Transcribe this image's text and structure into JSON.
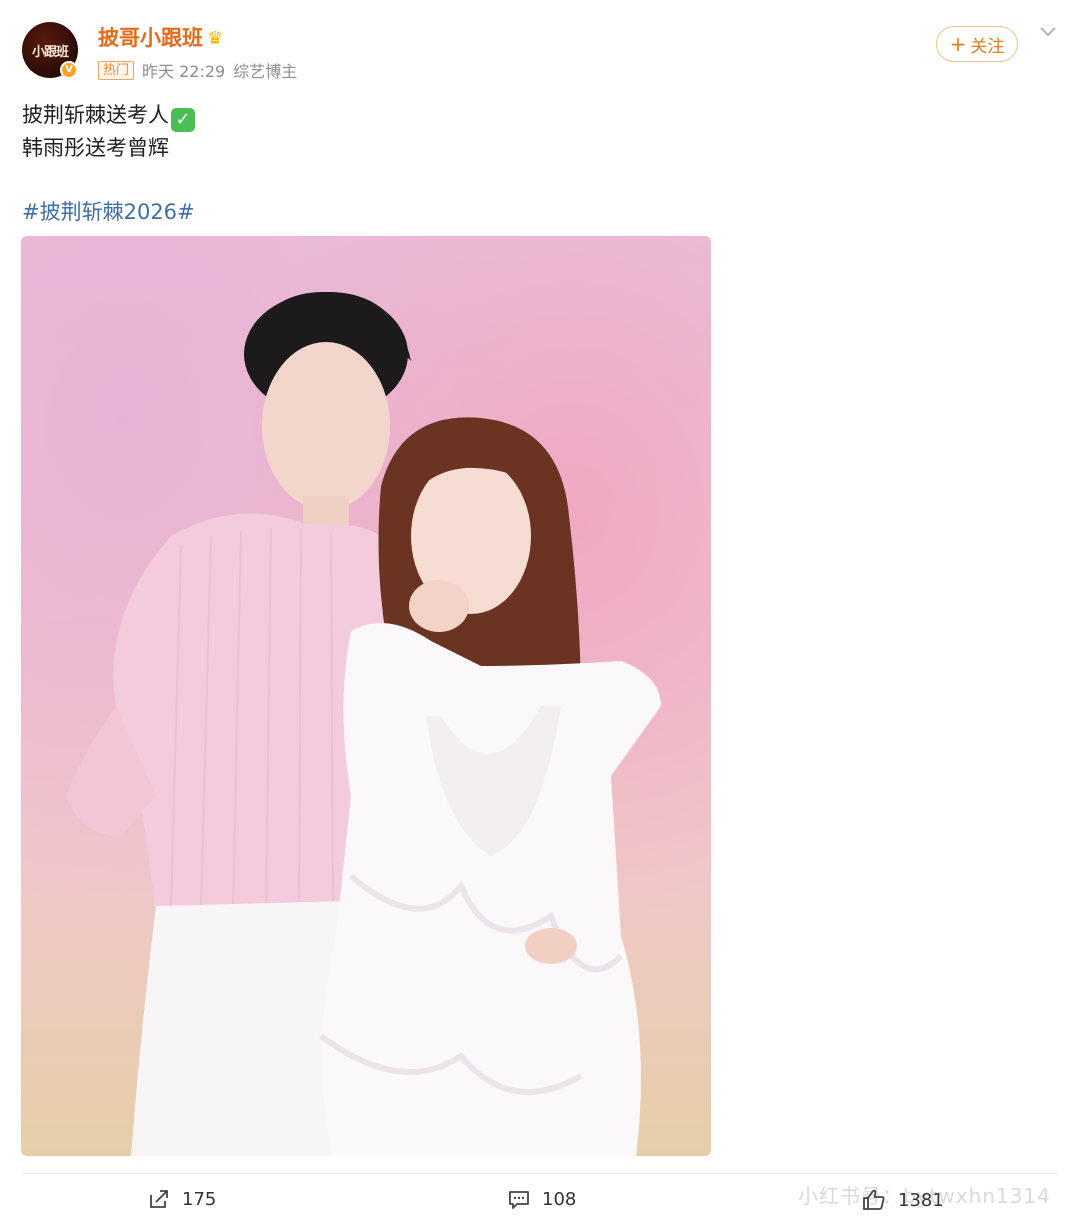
{
  "post": {
    "author": {
      "name": "披哥小跟班",
      "avatar_text": "小跟班",
      "verified_mark": "V",
      "crown_icon": "crown-icon"
    },
    "meta": {
      "badge": "热门",
      "time": "昨天 22:29",
      "role": "综艺博主"
    },
    "follow_label": "关注",
    "follow_plus": "+",
    "text_line1": "披荆斩棘送考人",
    "text_line2": "韩雨彤送考曾辉",
    "hashtag": "#披荆斩棘2026#",
    "actions": {
      "repost_count": "175",
      "comment_count": "108",
      "like_count": "1381"
    },
    "watermark": "小红书号：bytwxhn1314"
  },
  "colors": {
    "accent": "#e46b1b",
    "link": "#3f6fa8",
    "verified": "#f5a623",
    "check": "#4bbf55"
  }
}
